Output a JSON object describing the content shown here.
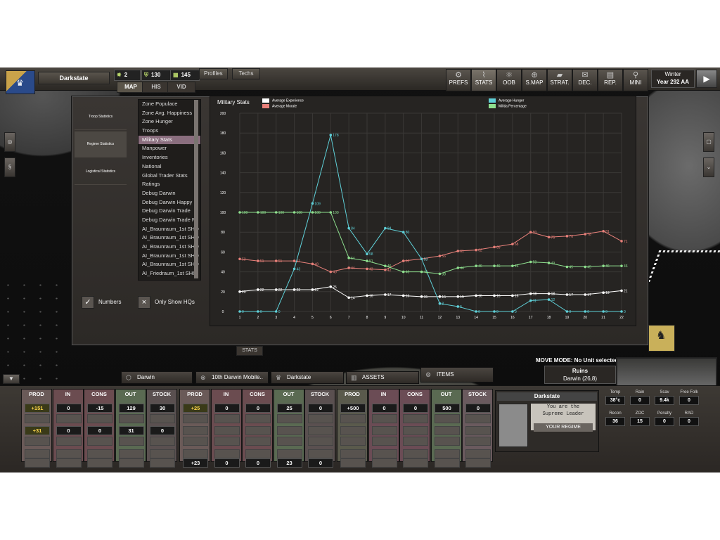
{
  "header": {
    "nation_name": "Darkstate",
    "resources": [
      {
        "icon": "star-icon",
        "value": "2"
      },
      {
        "icon": "shield-icon",
        "value": "130"
      },
      {
        "icon": "tank-icon",
        "value": "145"
      }
    ],
    "buttons": {
      "profiles": "Profiles",
      "techs": "Techs"
    },
    "tabs": [
      "MAP",
      "HIS",
      "VID"
    ],
    "nav": [
      {
        "label": "PREFS",
        "icon": "gear-icon"
      },
      {
        "label": "STATS",
        "icon": "chart-icon"
      },
      {
        "label": "OOB",
        "icon": "hierarchy-icon"
      },
      {
        "label": "S.MAP",
        "icon": "globe-icon"
      },
      {
        "label": "STRAT.",
        "icon": "card-icon"
      },
      {
        "label": "DEC.",
        "icon": "envelope-icon"
      },
      {
        "label": "REP.",
        "icon": "report-icon"
      },
      {
        "label": "MINI",
        "icon": "map-pin-icon"
      }
    ],
    "season": "Winter",
    "year": "Year 292 AA"
  },
  "stats_panel": {
    "sections": [
      "Troop Statistics",
      "Regime Statistics",
      "Logistical Statistics"
    ],
    "categories": [
      "Zone Populace",
      "Zone Avg. Happiness",
      "Zone Hunger",
      "Troops",
      "Military Stats",
      "Manpower",
      "Inventories",
      "National",
      "Global Trader Stats",
      "Ratings",
      "Debug Darwin",
      "Debug Darwin Happy",
      "Debug Darwin Trade",
      "Debug Darwin Trade Pr",
      "AI_Braunraum_1st SHQ",
      "AI_Braunraum_1st SHQ",
      "AI_Braunraum_1st SHQ",
      "AI_Braunraum_1st SHQ",
      "AI_Braunraum_1st SHQ",
      "AI_Friedraum_1st SHQ"
    ],
    "numbers_label": "Numbers",
    "only_hqs_label": "Only Show HQs",
    "tab_label": "STATS"
  },
  "chart_data": {
    "type": "line",
    "title": "Military Stats",
    "x": [
      1,
      2,
      3,
      4,
      5,
      6,
      7,
      8,
      9,
      10,
      11,
      12,
      13,
      14,
      15,
      16,
      17,
      18,
      19,
      20,
      21,
      22
    ],
    "ylim": [
      0,
      200
    ],
    "yticks": [
      0,
      20,
      40,
      60,
      80,
      100,
      120,
      140,
      160,
      180,
      200
    ],
    "grid": true,
    "series": [
      {
        "name": "Average Experience",
        "color": "#ffffff",
        "values": [
          20,
          22,
          22,
          22,
          22,
          25,
          14,
          16,
          17,
          16,
          15,
          15,
          15,
          16,
          16,
          16,
          18,
          18,
          17,
          17,
          19,
          21
        ]
      },
      {
        "name": "Average Morale",
        "color": "#e8807a",
        "values": [
          53,
          51,
          51,
          51,
          48,
          40,
          44,
          43,
          42,
          51,
          53,
          56,
          61,
          62,
          65,
          68,
          80,
          75,
          76,
          78,
          81,
          71
        ]
      },
      {
        "name": "Average Hunger",
        "color": "#5fd0d8",
        "values": [
          0,
          0,
          0,
          43,
          109,
          178,
          84,
          58,
          84,
          80,
          53,
          8,
          5,
          0,
          0,
          0,
          11,
          12,
          0,
          0,
          0,
          0
        ]
      },
      {
        "name": "Militia Percentage",
        "color": "#8fe08f",
        "values": [
          100,
          100,
          100,
          100,
          100,
          100,
          54,
          51,
          46,
          40,
          40,
          38,
          44,
          46,
          46,
          46,
          50,
          49,
          45,
          45,
          46,
          46
        ]
      }
    ]
  },
  "locations": {
    "tabs": [
      "Darwin",
      "10th Darwin Mobile..",
      "Darkstate",
      "ASSETS",
      "ITEMS"
    ],
    "move_mode": "MOVE MODE: No Unit selected",
    "hex_name": "Ruins",
    "hex_coords": "Darwin (26,8)"
  },
  "resource_groups": [
    {
      "type": "food",
      "columns": [
        {
          "h": "PROD",
          "bg": "#6a5a58",
          "cells": [
            "+151",
            "",
            "+31",
            "",
            "",
            ""
          ],
          "hi": [
            0,
            2
          ]
        },
        {
          "h": "IN",
          "bg": "#6b4c50",
          "cells": [
            "0",
            "",
            "0",
            "",
            "",
            ""
          ]
        },
        {
          "h": "CONS",
          "bg": "#6b4c50",
          "cells": [
            "-15",
            "",
            "0",
            "",
            "",
            ""
          ]
        },
        {
          "h": "OUT",
          "bg": "#5a6a52",
          "cells": [
            "129",
            "",
            "31",
            "",
            "",
            ""
          ]
        },
        {
          "h": "STOCK",
          "bg": "#5a5050",
          "cells": [
            "30",
            "",
            "0",
            "",
            "",
            ""
          ]
        }
      ]
    },
    {
      "type": "materials",
      "columns": [
        {
          "h": "PROD",
          "bg": "#6a5a58",
          "cells": [
            "+25",
            "",
            "",
            "",
            "",
            "+23"
          ],
          "hi": [
            0
          ]
        },
        {
          "h": "IN",
          "bg": "#6b4c50",
          "cells": [
            "0",
            "",
            "",
            "",
            "",
            "0"
          ]
        },
        {
          "h": "CONS",
          "bg": "#6b4c50",
          "cells": [
            "0",
            "",
            "",
            "",
            "",
            "0"
          ]
        },
        {
          "h": "OUT",
          "bg": "#5a6a52",
          "cells": [
            "25",
            "",
            "",
            "",
            "",
            "23"
          ]
        },
        {
          "h": "STOCK",
          "bg": "#5a5050",
          "cells": [
            "0",
            "",
            "",
            "",
            "",
            "0"
          ]
        }
      ]
    },
    {
      "type": "fuel",
      "columns": [
        {
          "h": "PROD",
          "bg": "#5a5a4c",
          "cells": [
            "+500",
            "",
            "",
            "",
            "",
            ""
          ]
        },
        {
          "h": "IN",
          "bg": "#6b4c55",
          "cells": [
            "0",
            "",
            "",
            "",
            "",
            ""
          ]
        },
        {
          "h": "CONS",
          "bg": "#6b4c55",
          "cells": [
            "0",
            "",
            "",
            "",
            "",
            ""
          ]
        },
        {
          "h": "OUT",
          "bg": "#5a6a52",
          "cells": [
            "500",
            "",
            "",
            "",
            "",
            ""
          ]
        },
        {
          "h": "STOCK",
          "bg": "#6a5a5e",
          "cells": [
            "0",
            "",
            "",
            "",
            "",
            ""
          ]
        }
      ]
    }
  ],
  "regime": {
    "title": "Darkstate",
    "message_line1": "You are the",
    "message_line2": "Supreme Leader",
    "button": "YOUR REGIME"
  },
  "hex_stats": [
    {
      "label": "Temp",
      "value": "38°c"
    },
    {
      "label": "Rain",
      "value": "0"
    },
    {
      "label": "Scav",
      "value": "9.4k"
    },
    {
      "label": "Free Folk",
      "value": "0"
    },
    {
      "label": "Recon",
      "value": "36"
    },
    {
      "label": "ZOC",
      "value": "15"
    },
    {
      "label": "Penalty",
      "value": "0"
    },
    {
      "label": "RAD",
      "value": "0"
    }
  ]
}
